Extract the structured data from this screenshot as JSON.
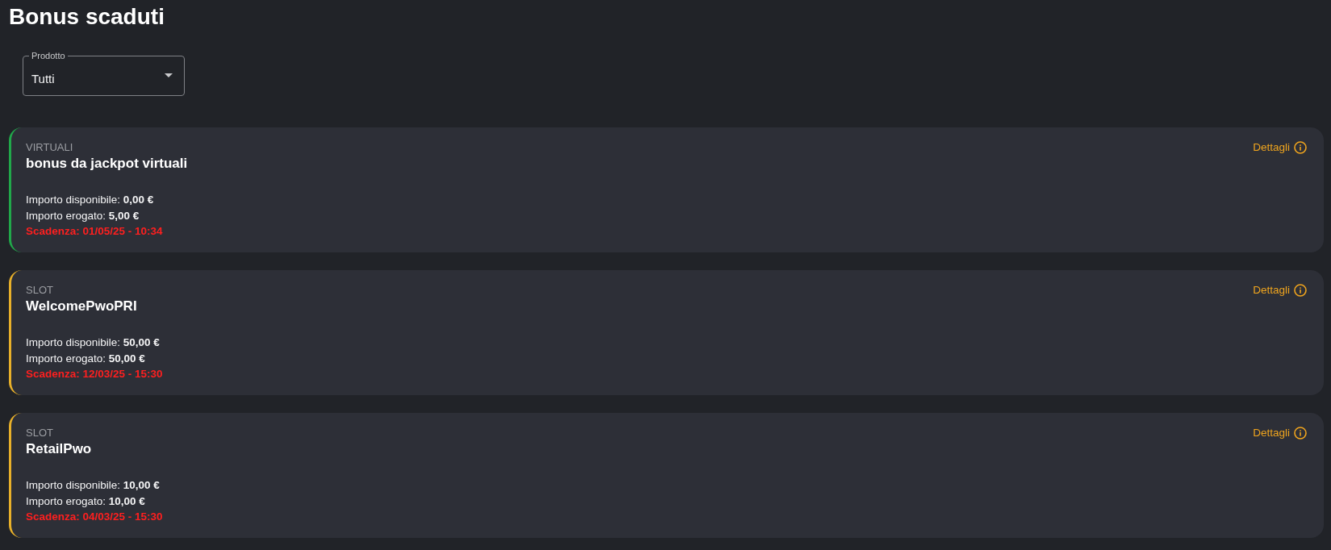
{
  "page": {
    "title": "Bonus scaduti"
  },
  "filter": {
    "label": "Prodotto",
    "value": "Tutti"
  },
  "bonuses": [
    {
      "category": "VIRTUALI",
      "name": "bonus da jackpot virtuali",
      "color": "#21a84a",
      "details_link": "Dettagli",
      "available": "Importo disponibile: **0,00 €**",
      "granted": "Importo erogato: **5,00 €**",
      "expiry": "Scadenza: 01/05/25 - 10:34"
    },
    {
      "category": "SLOT",
      "name": "WelcomePwoPRI",
      "color": "#e8b02a",
      "details_link": "Dettagli",
      "available": "Importo disponibile: **50,00 €**",
      "granted": "Importo erogato: **50,00 €**",
      "expiry": "Scadenza: 12/03/25 - 15:30"
    },
    {
      "category": "SLOT",
      "name": "RetailPwo",
      "color": "#e8b02a",
      "details_link": "Dettagli",
      "available": "Importo disponibile: **10,00 €**",
      "granted": "Importo erogato: **10,00 €**",
      "expiry": "Scadenza: 04/03/25 - 15:30"
    }
  ]
}
